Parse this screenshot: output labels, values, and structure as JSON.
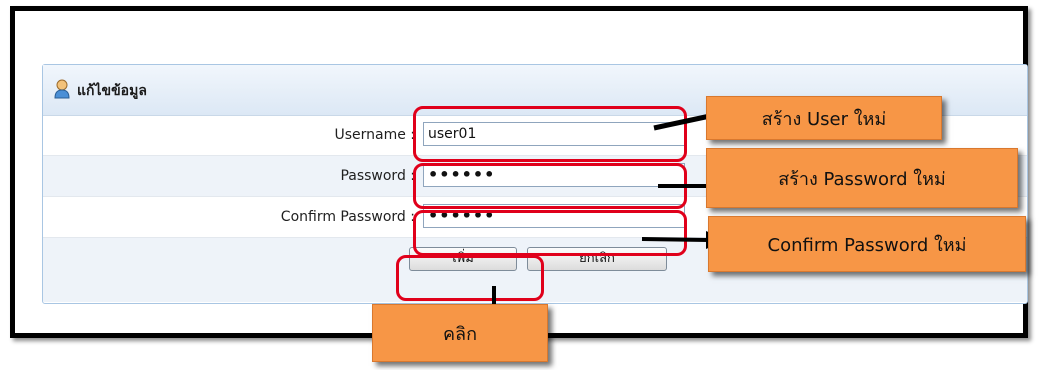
{
  "panel": {
    "title": "แก้ไขข้อมูล",
    "title_icon": "user-icon"
  },
  "form": {
    "username_label": "Username :",
    "username_value": "user01",
    "password_label": "Password :",
    "password_value": "••••••",
    "confirm_label": "Confirm Password :",
    "confirm_value": "••••••",
    "add_button": "เพิ่ม",
    "cancel_button": "ยกเลิก"
  },
  "annotations": {
    "user_callout": "สร้าง User ใหม่",
    "password_callout": "สร้าง Password ใหม่",
    "confirm_callout": "Confirm Password ใหม่",
    "click_callout": "คลิก"
  },
  "colors": {
    "highlight_red": "#e0001b",
    "callout_orange": "#f79646",
    "panel_border": "#a9c6e3"
  }
}
